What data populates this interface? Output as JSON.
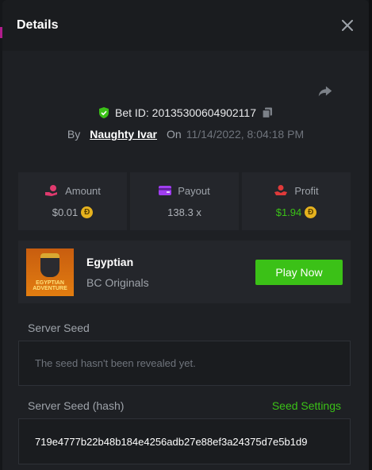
{
  "header": {
    "title": "Details"
  },
  "bet": {
    "id_label": "Bet ID: 20135300604902117",
    "by_label": "By",
    "user": "Naughty Ivar",
    "on_label": "On",
    "date": "11/14/2022, 8:04:18 PM"
  },
  "stats": {
    "amount": {
      "label": "Amount",
      "value": "$0.01"
    },
    "payout": {
      "label": "Payout",
      "value": "138.3 x"
    },
    "profit": {
      "label": "Profit",
      "value": "$1.94"
    }
  },
  "game": {
    "name": "Egyptian",
    "provider": "BC Originals",
    "thumb_text": "EGYPTIAN ADVENTURE",
    "play_label": "Play Now"
  },
  "seeds": {
    "server_seed_label": "Server Seed",
    "server_seed_value": "The seed hasn't been revealed yet.",
    "hash_label": "Server Seed (hash)",
    "seed_settings_label": "Seed Settings",
    "hash_value": "719e4777b22b48b184e4256adb27e88ef3a24375d7e5b1d9"
  },
  "colors": {
    "accent_green": "#3bc117",
    "coin_gold": "#e6b21e",
    "amount_icon": "#e03a6e",
    "payout_icon": "#a03ef0",
    "profit_icon": "#e03a3a"
  },
  "icons": {
    "close": "close-icon",
    "share": "share-icon",
    "verified": "shield-check-icon",
    "copy": "copy-icon",
    "amount": "money-hand-icon",
    "payout": "wallet-icon",
    "profit": "hand-coin-icon",
    "coin": "coin-icon"
  }
}
